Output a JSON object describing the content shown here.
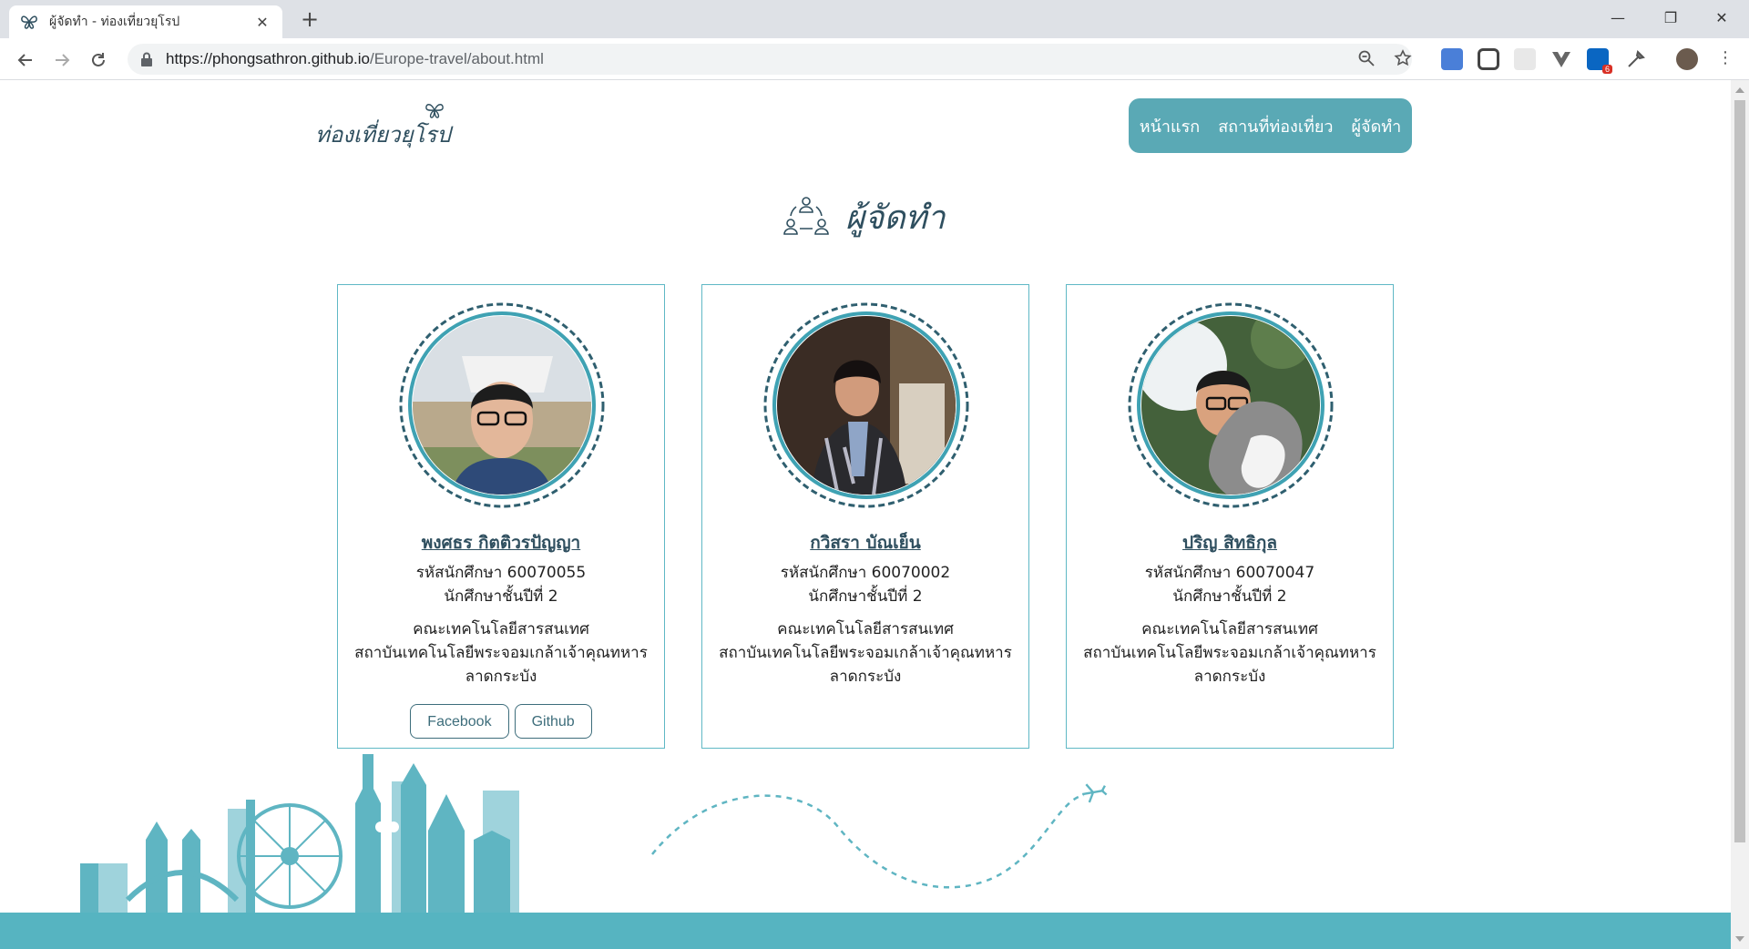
{
  "browser": {
    "tab_title": "ผู้จัดทำ - ท่องเที่ยวยุโรป",
    "url_host": "https://phongsathron.github.io",
    "url_path": "/Europe-travel/about.html",
    "new_tab": "+",
    "close_tab": "✕",
    "extension_badge": "6"
  },
  "site": {
    "logo": "ท่องเที่ยวยุโรป",
    "nav": [
      "หน้าแรก",
      "สถานที่ท่องเที่ยว",
      "ผู้จัดทำ"
    ]
  },
  "page_title": "ผู้จัดทำ",
  "members": [
    {
      "name": "พงศธร กิตติวรปัญญา",
      "student_id": "รหัสนักศึกษา 60070055",
      "year": "นักศึกษาชั้นปีที่ 2",
      "faculty": "คณะเทคโนโลยีสารสนเทศ",
      "institute": "สถาบันเทคโนโลยีพระจอมเกล้าเจ้าคุณทหาร",
      "campus": "ลาดกระบัง",
      "buttons": [
        "Facebook",
        "Github"
      ]
    },
    {
      "name": "กวิสรา บัณเย็น",
      "student_id": "รหัสนักศึกษา 60070002",
      "year": "นักศึกษาชั้นปีที่ 2",
      "faculty": "คณะเทคโนโลยีสารสนเทศ",
      "institute": "สถาบันเทคโนโลยีพระจอมเกล้าเจ้าคุณทหาร",
      "campus": "ลาดกระบัง"
    },
    {
      "name": "ปริญ สิทธิกุล",
      "student_id": "รหัสนักศึกษา 60070047",
      "year": "นักศึกษาชั้นปีที่ 2",
      "faculty": "คณะเทคโนโลยีสารสนเทศ",
      "institute": "สถาบันเทคโนโลยีพระจอมเกล้าเจ้าคุณทหาร",
      "campus": "ลาดกระบัง"
    }
  ],
  "colors": {
    "accent": "#5aa9b5",
    "heading": "#2f4f5f",
    "card_border": "#5fb8c5",
    "footer": "#56b4c1"
  }
}
